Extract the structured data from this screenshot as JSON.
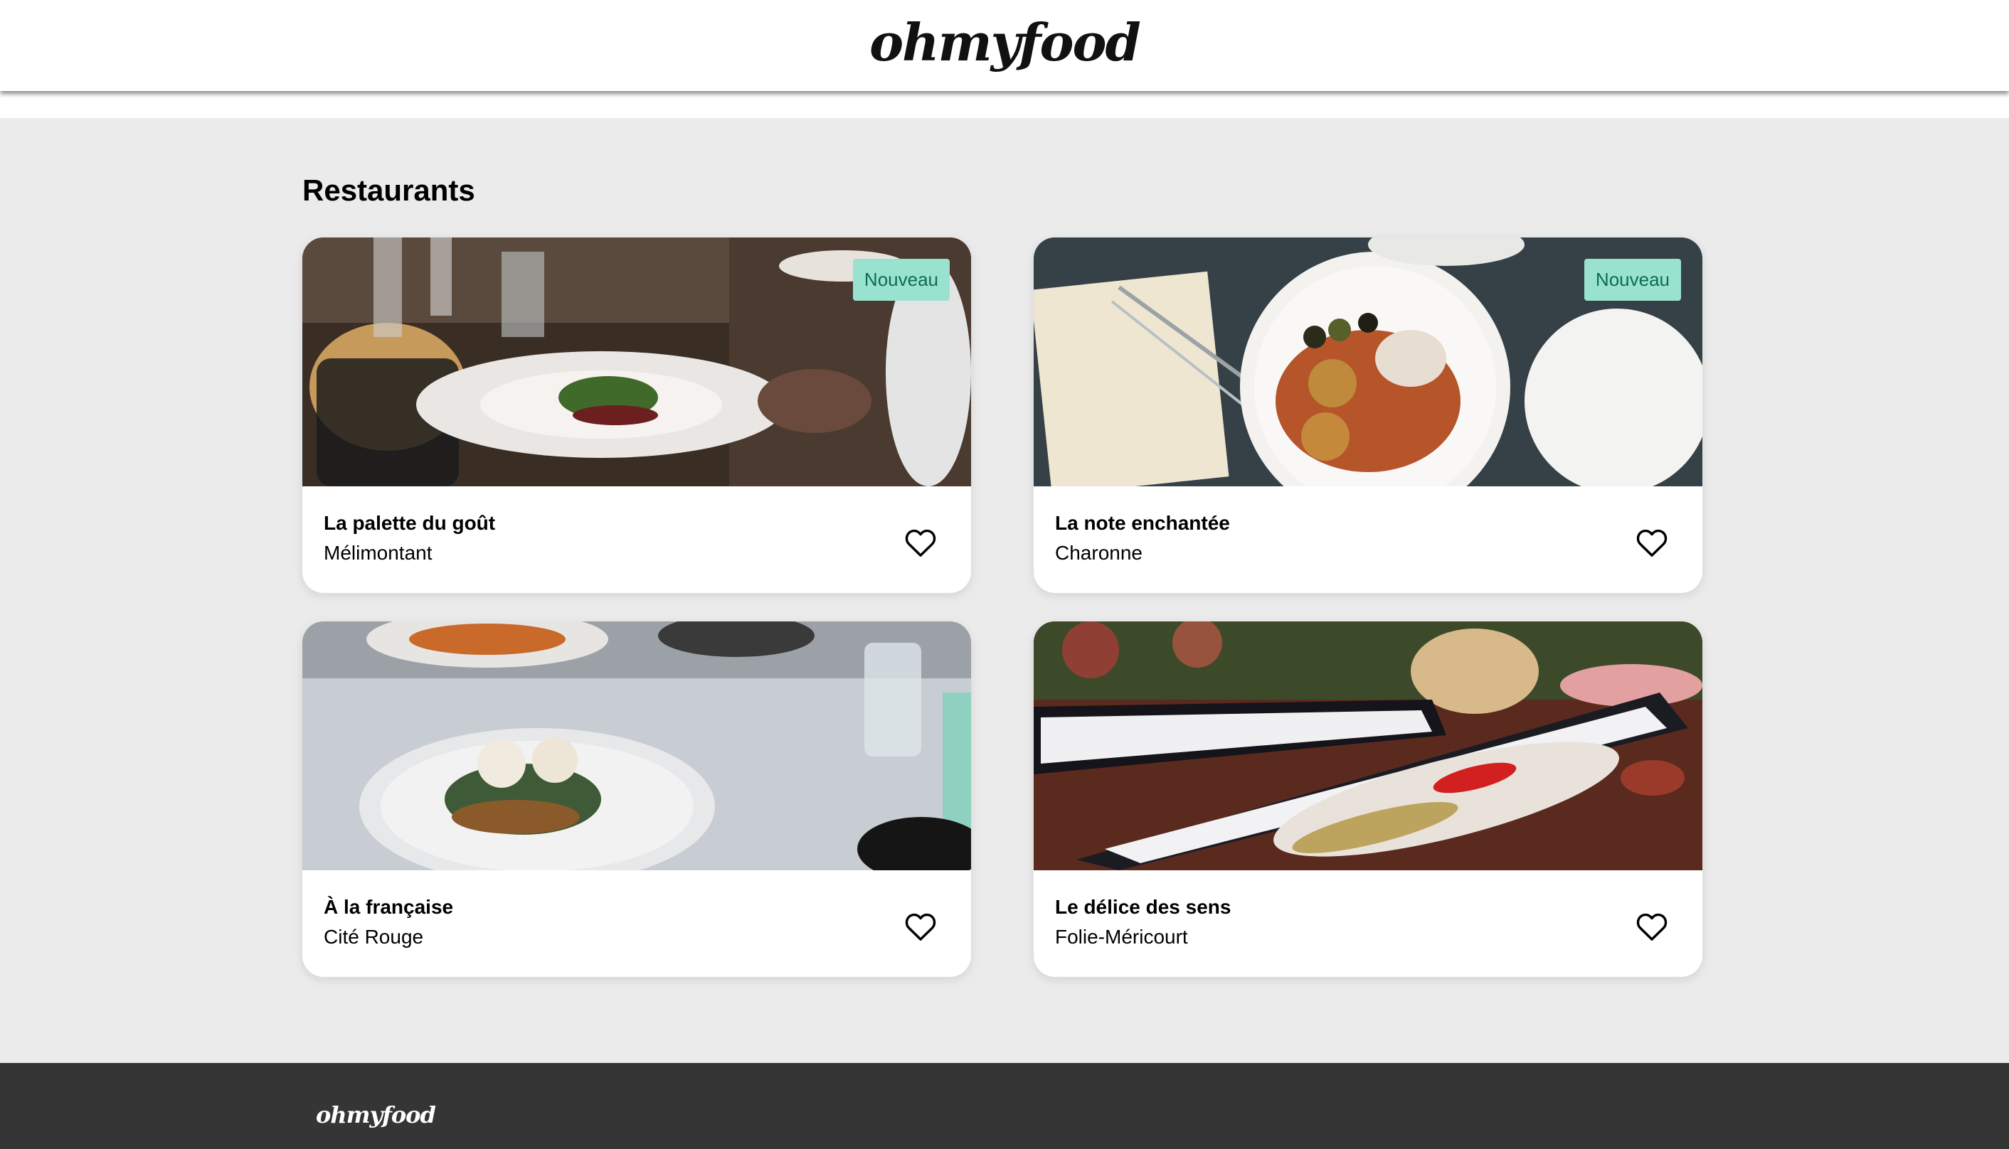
{
  "header": {
    "logo_text": "ohmyfood"
  },
  "main": {
    "section_title": "Restaurants",
    "restaurants": [
      {
        "name": "La palette du goût",
        "location": "Mélimontant",
        "badge": "Nouveau",
        "favorite_icon": "heart-outline-icon"
      },
      {
        "name": "La note enchantée",
        "location": "Charonne",
        "badge": "Nouveau",
        "favorite_icon": "heart-outline-icon"
      },
      {
        "name": "À la française",
        "location": "Cité Rouge",
        "badge": "",
        "favorite_icon": "heart-outline-icon"
      },
      {
        "name": "Le délice des sens",
        "location": "Folie-Méricourt",
        "badge": "",
        "favorite_icon": "heart-outline-icon"
      }
    ]
  },
  "footer": {
    "logo_text": "ohmyfood"
  },
  "colors": {
    "badge_bg": "#99e2d0",
    "badge_text": "#0f6b55",
    "page_bg": "#ebebeb",
    "footer_bg": "#353535"
  }
}
